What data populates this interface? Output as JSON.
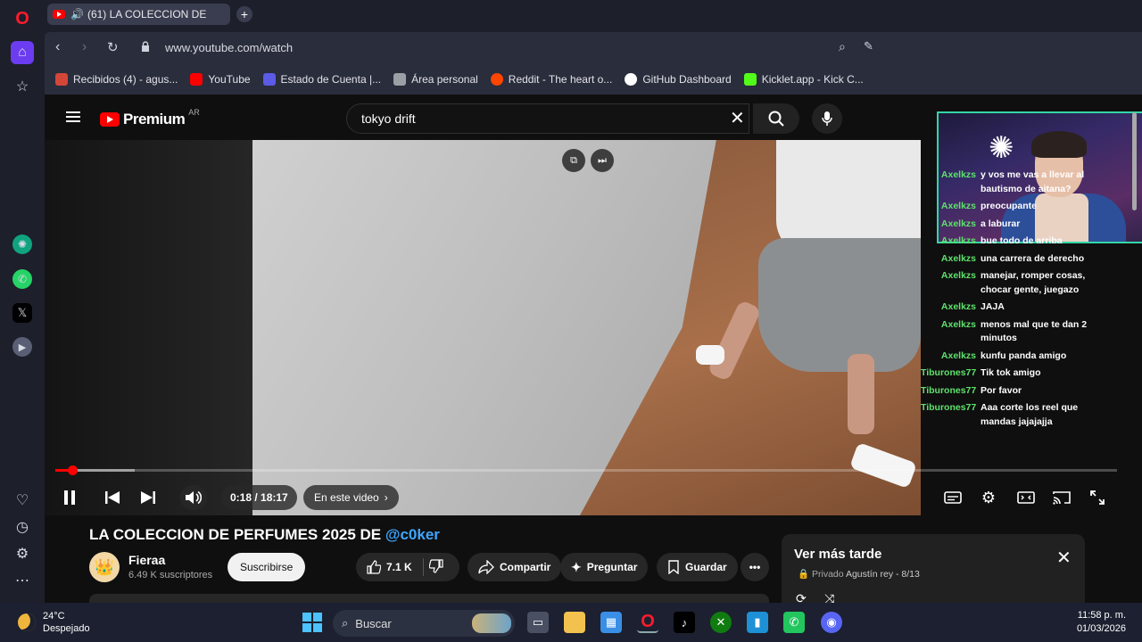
{
  "browser": {
    "tab_title": "(61) LA COLECCION DE",
    "url": "www.youtube.com/watch",
    "bookmarks": [
      {
        "label": "Recibidos (4) - agus...",
        "color": "#d44638"
      },
      {
        "label": "YouTube",
        "color": "#ff0000"
      },
      {
        "label": "Estado de Cuenta |...",
        "color": "#5b5be8"
      },
      {
        "label": "Área personal",
        "color": "#9aa0a6"
      },
      {
        "label": "Reddit - The heart o...",
        "color": "#ff4500"
      },
      {
        "label": "GitHub Dashboard",
        "color": "#ffffff"
      },
      {
        "label": "Kicklet.app - Kick C...",
        "color": "#53fc18"
      }
    ]
  },
  "youtube": {
    "logo_text": "Premium",
    "region": "AR",
    "search_value": "tokyo drift",
    "video": {
      "time": "0:18 / 18:17",
      "chapter_label": "En este video",
      "progress_played": 0.016,
      "progress_buffered": 0.075
    },
    "title_main": "LA COLECCION DE PERFUMES 2025 DE ",
    "title_mention": "@c0ker",
    "channel": {
      "name": "Fieraa",
      "subs": "6.49 K suscriptores",
      "subscribe_label": "Suscribirse"
    },
    "actions": {
      "likes": "7.1 K",
      "share": "Compartir",
      "ask": "Preguntar",
      "save": "Guardar"
    },
    "watch_later": {
      "title": "Ver más tarde",
      "privacy": "Privado",
      "owner": "Agustín rey - 8/13"
    }
  },
  "chat": [
    {
      "user": "Axelkzs",
      "msg": "y vos me vas a llevar al bautismo de aitana?"
    },
    {
      "user": "Axelkzs",
      "msg": "preocupante"
    },
    {
      "user": "Axelkzs",
      "msg": "a laburar"
    },
    {
      "user": "Axelkzs",
      "msg": "bue todo de arriba"
    },
    {
      "user": "Axelkzs",
      "msg": "una carrera de derecho"
    },
    {
      "user": "Axelkzs",
      "msg": "manejar, romper cosas, chocar gente, juegazo"
    },
    {
      "user": "Axelkzs",
      "msg": "JAJA"
    },
    {
      "user": "Axelkzs",
      "msg": "menos mal que te dan 2 minutos"
    },
    {
      "user": "Axelkzs",
      "msg": "kunfu panda amigo"
    },
    {
      "user": "Tiburones77",
      "msg": "Tik tok amigo"
    },
    {
      "user": "Tiburones77",
      "msg": "Por favor"
    },
    {
      "user": "Tiburones77",
      "msg": "Aaa corte los reel que mandas jajajajja"
    }
  ],
  "taskbar": {
    "temp": "24°C",
    "weather": "Despejado",
    "search_placeholder": "Buscar",
    "time": "11:58 p. m.",
    "date": "01/03/2026"
  }
}
